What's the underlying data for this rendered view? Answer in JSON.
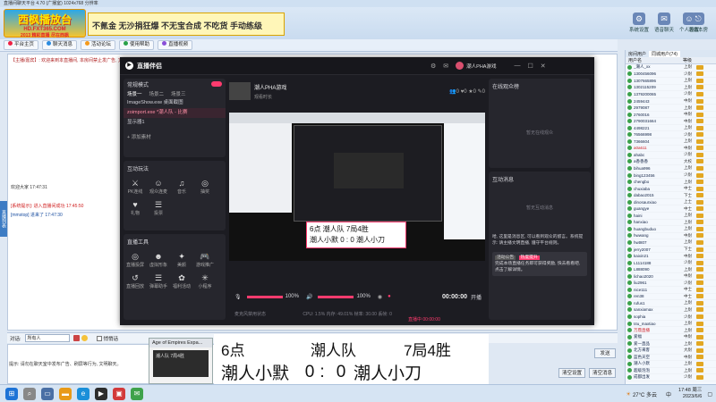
{
  "window": {
    "title": "直播间聊天平台 4.70 (广播室) 1024x768 分辨率"
  },
  "banner": {
    "logo_line1": "西枫播放台",
    "logo_line2": "HD.FXT365.COM",
    "logo_line3": "2013 精彩直播 尽在西枫",
    "slogan": "不氪金 无沙捐狂爆 不无宝合成 不吃货 手动练级",
    "icons": [
      {
        "label": "系统设置",
        "icon": "gear-icon"
      },
      {
        "label": "语音聊天",
        "icon": "chat-icon"
      },
      {
        "label": "个人设置",
        "icon": "user-icon"
      },
      {
        "label": "退出本房",
        "icon": "exit-icon"
      }
    ]
  },
  "toolbar": {
    "buttons": [
      "平台主页",
      "聊天消息",
      "活动论坛",
      "使用帮助",
      "直播视频"
    ]
  },
  "chat": {
    "line1": "【主播/嘉宾】: 欢迎来到本直播间, 本房间禁止发广告, 文明聊天, 严禁刷屏",
    "line2": "[系统提示]: 进入直播间成功 17:45:50",
    "line3": "[mmstop] 进来了 17:47:30",
    "line4": "欢迎大家 17:47:31"
  },
  "left_strip": "直播列表",
  "user_list": {
    "tabs": [
      "房间用户",
      "同城用户(74)"
    ],
    "headers": [
      "用户名",
      "等级"
    ],
    "users": [
      {
        "name": "_潮人_xx",
        "level": "上尉",
        "red": false
      },
      {
        "name": "1300456096",
        "level": "少尉",
        "red": false
      },
      {
        "name": "1307665896",
        "level": "上尉",
        "red": false
      },
      {
        "name": "1302115209",
        "level": "上尉",
        "red": false
      },
      {
        "name": "1379200065",
        "level": "少尉",
        "red": false
      },
      {
        "name": "2459443",
        "level": "中尉",
        "red": false
      },
      {
        "name": "2979087",
        "level": "上尉",
        "red": false
      },
      {
        "name": "2760016",
        "level": "中尉",
        "red": false
      },
      {
        "name": "2790031664",
        "level": "中尉",
        "red": false
      },
      {
        "name": "4498221",
        "level": "上尉",
        "red": false
      },
      {
        "name": "76566998",
        "level": "少尉",
        "red": false
      },
      {
        "name": "7366604",
        "level": "上尉",
        "red": false
      },
      {
        "name": "a0a611",
        "level": "中尉",
        "red": true
      },
      {
        "name": "ahabc",
        "level": "少尉",
        "red": false
      },
      {
        "name": "a香香香",
        "level": "大校",
        "red": false
      },
      {
        "name": "bihua996",
        "level": "上尉",
        "red": false
      },
      {
        "name": "bing123456",
        "level": "少尉",
        "red": false
      },
      {
        "name": "chengbo",
        "level": "上尉",
        "red": false
      },
      {
        "name": "chuxiaba",
        "level": "中士",
        "red": false
      },
      {
        "name": "dabao2015",
        "level": "下士",
        "red": false
      },
      {
        "name": "dinosaurxiao",
        "level": "上士",
        "red": false
      },
      {
        "name": "guangye",
        "level": "中士",
        "red": false
      },
      {
        "name": "haini",
        "level": "上尉",
        "red": false
      },
      {
        "name": "hanxiao",
        "level": "上尉",
        "red": false
      },
      {
        "name": "huangbuduo",
        "level": "上尉",
        "red": false
      },
      {
        "name": "hwwang",
        "level": "中尉",
        "red": false
      },
      {
        "name": "hwt807",
        "level": "上尉",
        "red": false
      },
      {
        "name": "jerry2007",
        "level": "下士",
        "red": false
      },
      {
        "name": "kaixin21",
        "level": "中尉",
        "red": false
      },
      {
        "name": "L1114188",
        "level": "少尉",
        "red": false
      },
      {
        "name": "L888090",
        "level": "上尉",
        "red": false
      },
      {
        "name": "lichao2020",
        "level": "中尉",
        "red": false
      },
      {
        "name": "liu2961",
        "level": "少尉",
        "red": false
      },
      {
        "name": "nice111",
        "level": "中士",
        "red": false
      },
      {
        "name": "ren38",
        "level": "中士",
        "red": false
      },
      {
        "name": "rufus1",
        "level": "上尉",
        "red": false
      },
      {
        "name": "sanxiamax",
        "level": "上尉",
        "red": false
      },
      {
        "name": "sophia",
        "level": "少尉",
        "red": false
      },
      {
        "name": "t4u_maxtiao",
        "level": "上尉",
        "red": false
      },
      {
        "name": "万鼎直播",
        "level": "上尉",
        "red": true
      },
      {
        "name": "爱福",
        "level": "中尉",
        "red": false
      },
      {
        "name": "爱一直品",
        "level": "上尉",
        "red": false
      },
      {
        "name": "北方来客",
        "level": "大尉",
        "red": false
      },
      {
        "name": "蓝色天空",
        "level": "中尉",
        "red": false
      },
      {
        "name": "潮人小默",
        "level": "上尉",
        "red": false
      },
      {
        "name": "超级泡泡",
        "level": "上尉",
        "red": false
      },
      {
        "name": "成都出发",
        "level": "少尉",
        "red": false
      }
    ]
  },
  "input": {
    "to_label": "对话:",
    "to_value": "所有人",
    "private_label": "悄悄话",
    "tip": "提示: 请勿在聊天室中发布广告、刷屏等行为, 文明聊天。",
    "send": "发送",
    "btn1": "清空设置",
    "btn2": "清空消息"
  },
  "stream": {
    "app_name": "直播伴侣",
    "mode_label": "常规模式",
    "scene_tabs": [
      "场景一",
      "场景二",
      "场景三"
    ],
    "add_scene": "+ 添加场景",
    "sources": [
      {
        "name": "ImageShow.exe 桌面截图",
        "active": false
      },
      {
        "name": "zoimport.exe *潮人队 - 比赛",
        "active": true
      },
      {
        "name": "显示器1",
        "active": false
      }
    ],
    "add_source": "+ 添加素材",
    "interact_title": "互动玩法",
    "interact_tools": [
      "PK连线",
      "观众连麦",
      "音乐",
      "抽奖",
      "礼物",
      "投票"
    ],
    "live_tools_title": "直播工具",
    "live_tools": [
      "直播投屏",
      "虚拟形象",
      "美颜",
      "游戏推广",
      "直播回放",
      "弹幕助手",
      "福利活动",
      "小程序"
    ],
    "room_title": "潮人PHA游戏",
    "room_sub": "观看时长",
    "mute_hint": "麦克风禁用状态",
    "volume_pct": 100,
    "volume_pct_2": 100,
    "timer": "00:00:00",
    "go_live": "开播",
    "cpu_text": "CPU: 1.5%  内存: 49.01%  帧率: 30.00  丢帧: 0",
    "stream_status": "直播中 00:00:00",
    "online_title": "在线观众榜",
    "online_empty": "暂无在线观众",
    "msg_title": "互动消息",
    "msg_empty": "暂无互动消息",
    "notice": "哈, 这里是消息区, 可以看到观众的留言。系统提示: 请主播文明直播, 遵守平台规则。",
    "card_title": "活动公告",
    "card_tag": "热度提升",
    "card_text": "完成本场直播任务即可获得奖励, 快去看看吧, 点击了解详情。",
    "broadcaster": "潮人PHA游戏"
  },
  "preview": {
    "score_line1": "6点  潮人队  7局4胜",
    "score_line2": "潮人小默  0 : 0  潮人小刀"
  },
  "aoe": {
    "title": "Age of Empires Expa...",
    "inner1": "潮人队",
    "inner2": "7局4胜"
  },
  "scoreboard": {
    "time": "6点",
    "team": "潮人队",
    "format": "7局4胜",
    "player1": "潮人小默",
    "score1": "0",
    "sep": ":",
    "score2": "0",
    "player2": "潮人小刀"
  },
  "taskbar": {
    "weather": "27°C 多云",
    "time": "17:48 周三",
    "date": "2023/6/6",
    "lang": "中"
  }
}
